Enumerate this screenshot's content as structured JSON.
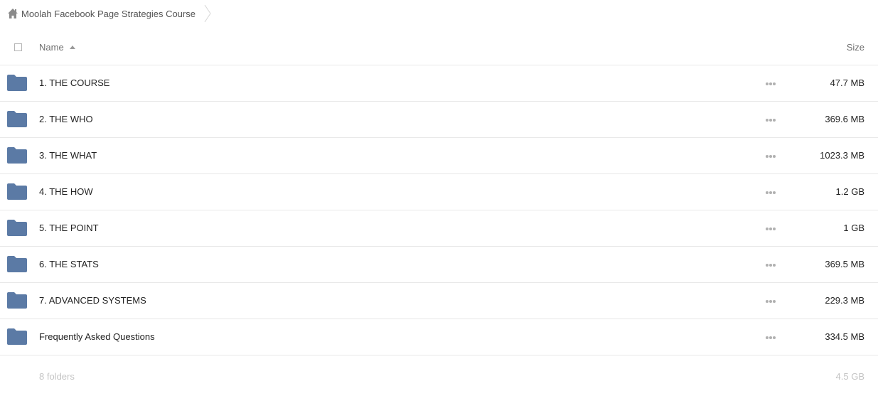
{
  "breadcrumb": {
    "icon": "home-icon",
    "label": "Moolah Facebook Page Strategies Course"
  },
  "header": {
    "name_label": "Name",
    "size_label": "Size",
    "sort": "ascending"
  },
  "colors": {
    "folder": "#5b7aa5",
    "divider": "#e8e8e8",
    "muted_text": "#c4c4c4"
  },
  "rows": [
    {
      "name": "1. THE COURSE",
      "size": "47.7 MB",
      "icon": "folder-icon"
    },
    {
      "name": "2. THE WHO",
      "size": "369.6 MB",
      "icon": "folder-icon"
    },
    {
      "name": "3. THE WHAT",
      "size": "1023.3 MB",
      "icon": "folder-icon"
    },
    {
      "name": "4. THE HOW",
      "size": "1.2 GB",
      "icon": "folder-icon"
    },
    {
      "name": "5. THE POINT",
      "size": "1 GB",
      "icon": "folder-icon"
    },
    {
      "name": "6. THE STATS",
      "size": "369.5 MB",
      "icon": "folder-icon"
    },
    {
      "name": "7. ADVANCED SYSTEMS",
      "size": "229.3 MB",
      "icon": "folder-icon"
    },
    {
      "name": "Frequently Asked Questions",
      "size": "334.5 MB",
      "icon": "folder-icon"
    }
  ],
  "footer": {
    "count": "8 folders",
    "total": "4.5 GB"
  }
}
